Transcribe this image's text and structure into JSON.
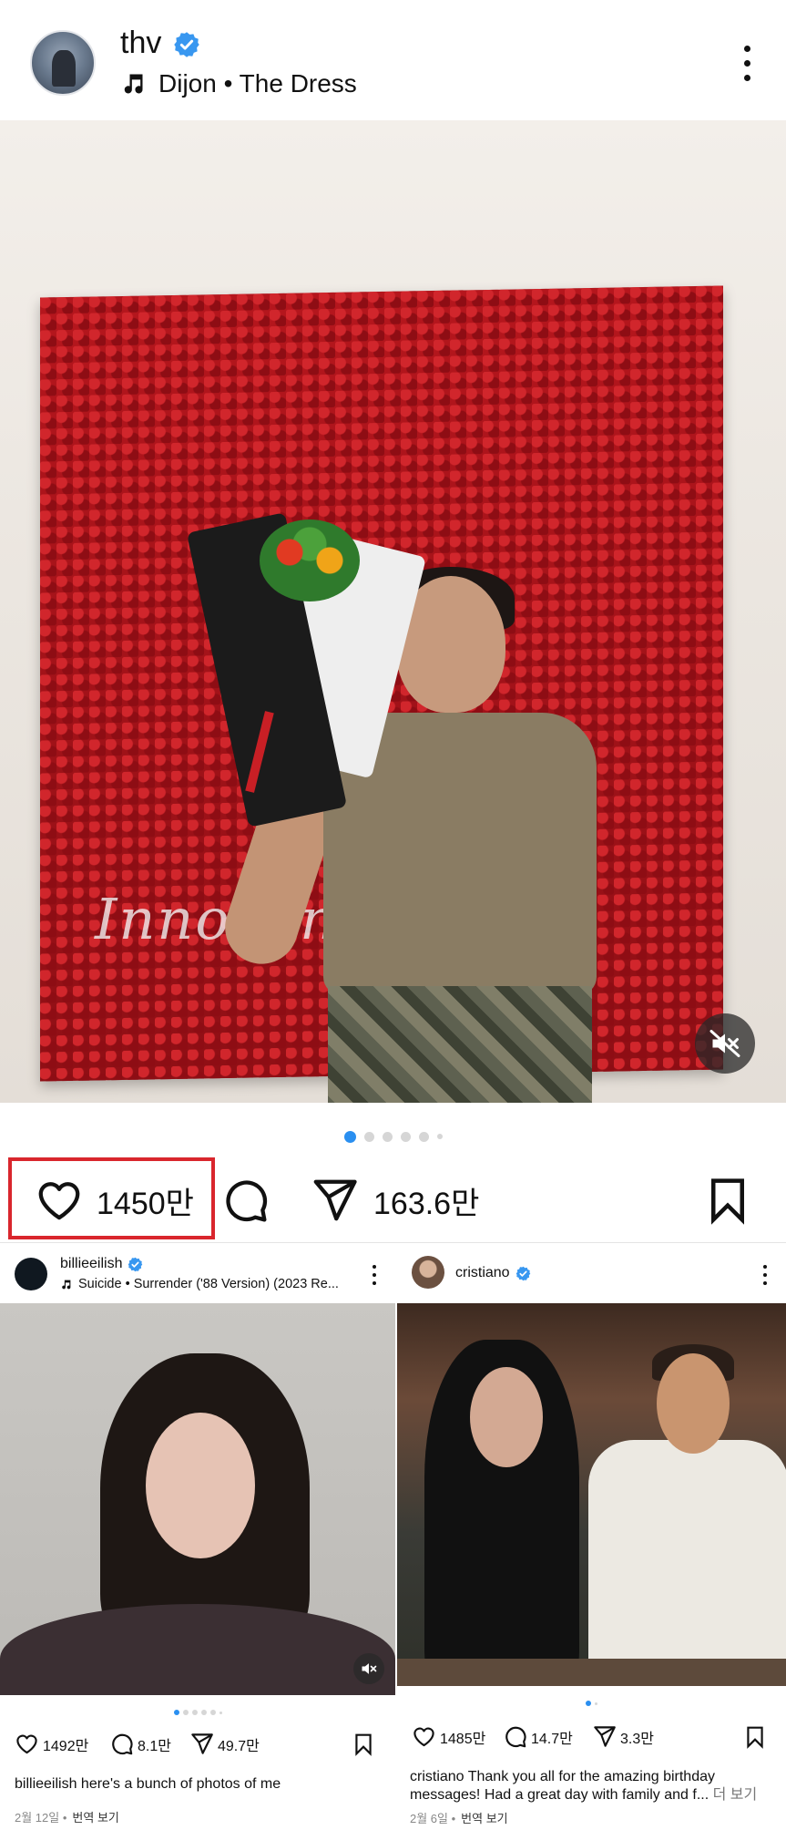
{
  "header": {
    "username": "thv",
    "music": "Dijon • The Dress"
  },
  "main_post": {
    "wall_text": "Innocent is   ty",
    "carousel": {
      "total_visible_dots": 6,
      "active_index": 0
    },
    "likes": "1450만",
    "shares": "163.6만",
    "highlight_color": "#d9262d"
  },
  "grid_posts": [
    {
      "username": "billieeilish",
      "music": "Suicide • Surrender ('88 Version) (2023 Re...",
      "likes": "1492만",
      "comments": "8.1만",
      "shares": "49.7만",
      "caption": "billieeilish here's a bunch of photos of me",
      "caption_more": "",
      "date": "2월 12일",
      "translate": "번역 보기"
    },
    {
      "username": "cristiano",
      "music": "",
      "likes": "1485만",
      "comments": "14.7만",
      "shares": "3.3만",
      "caption": "cristiano Thank you all for the amazing birthday messages! Had a great day with family and f...",
      "caption_more": "더 보기",
      "date": "2월 6일",
      "translate": "번역 보기"
    }
  ],
  "colors": {
    "verified": "#3897f0",
    "active_dot": "#2a8ff0"
  }
}
